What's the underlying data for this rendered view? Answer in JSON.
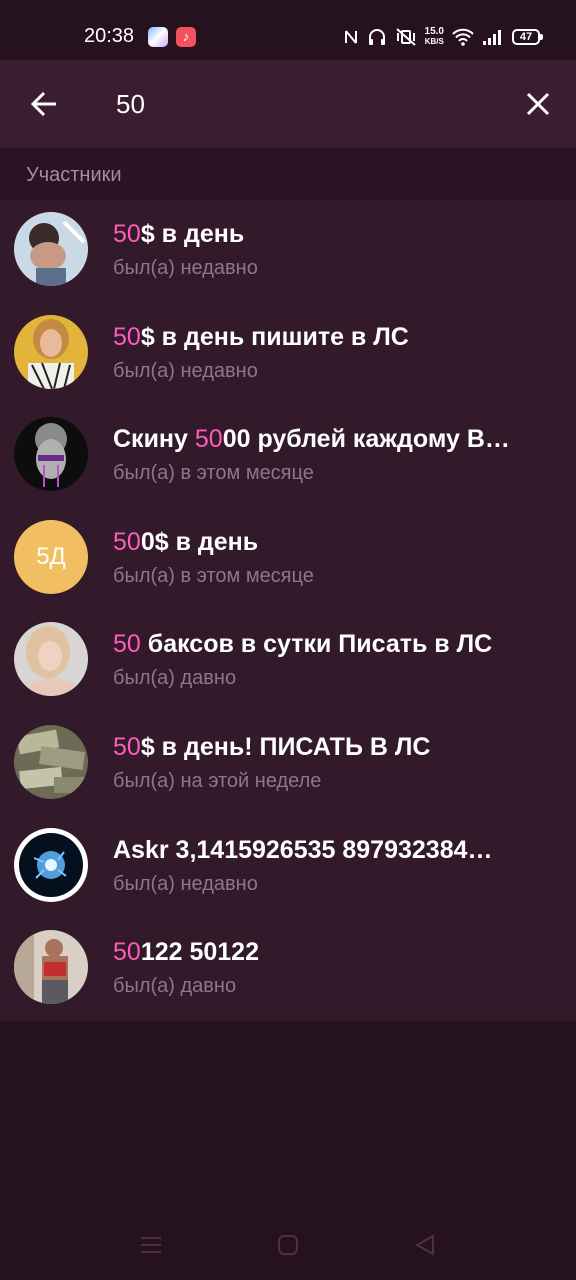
{
  "status_bar": {
    "time": "20:38",
    "app2_icon": "music-note-icon",
    "net_speed_value": "15.0",
    "net_speed_unit": "KB/S",
    "battery": "47"
  },
  "search": {
    "value": "50",
    "placeholder": ""
  },
  "section": {
    "title": "Участники"
  },
  "colors": {
    "background": "#26121f",
    "list_background": "#321a2a",
    "highlight": "#ff5bbd",
    "secondary_text": "#8f7688"
  },
  "results": [
    {
      "title_hl": "50",
      "title_rest": "$ в день",
      "status": "был(а) недавно"
    },
    {
      "title_hl": "50",
      "title_rest": "$ в день пишите в ЛС",
      "status": "был(а) недавно"
    },
    {
      "title_pre": "Скину ",
      "title_hl": "50",
      "title_rest": "00 рублей каждому В…",
      "status": "был(а) в этом месяце"
    },
    {
      "title_hl": "50",
      "title_rest": "0$ в день",
      "status": "был(а) в этом месяце",
      "initials": "5Д"
    },
    {
      "title_hl": "50",
      "title_rest": " баксов в сутки Писать в ЛС",
      "status": "был(а) давно"
    },
    {
      "title_hl": "50",
      "title_rest": "$ в день! ПИСАТЬ В ЛС",
      "status": "был(а) на этой неделе"
    },
    {
      "title_rest": "Askr 3,1415926535 897932384…",
      "status": "был(а) недавно"
    },
    {
      "title_hl": "50",
      "title_rest": "122 50122",
      "status": "был(а) давно"
    }
  ]
}
